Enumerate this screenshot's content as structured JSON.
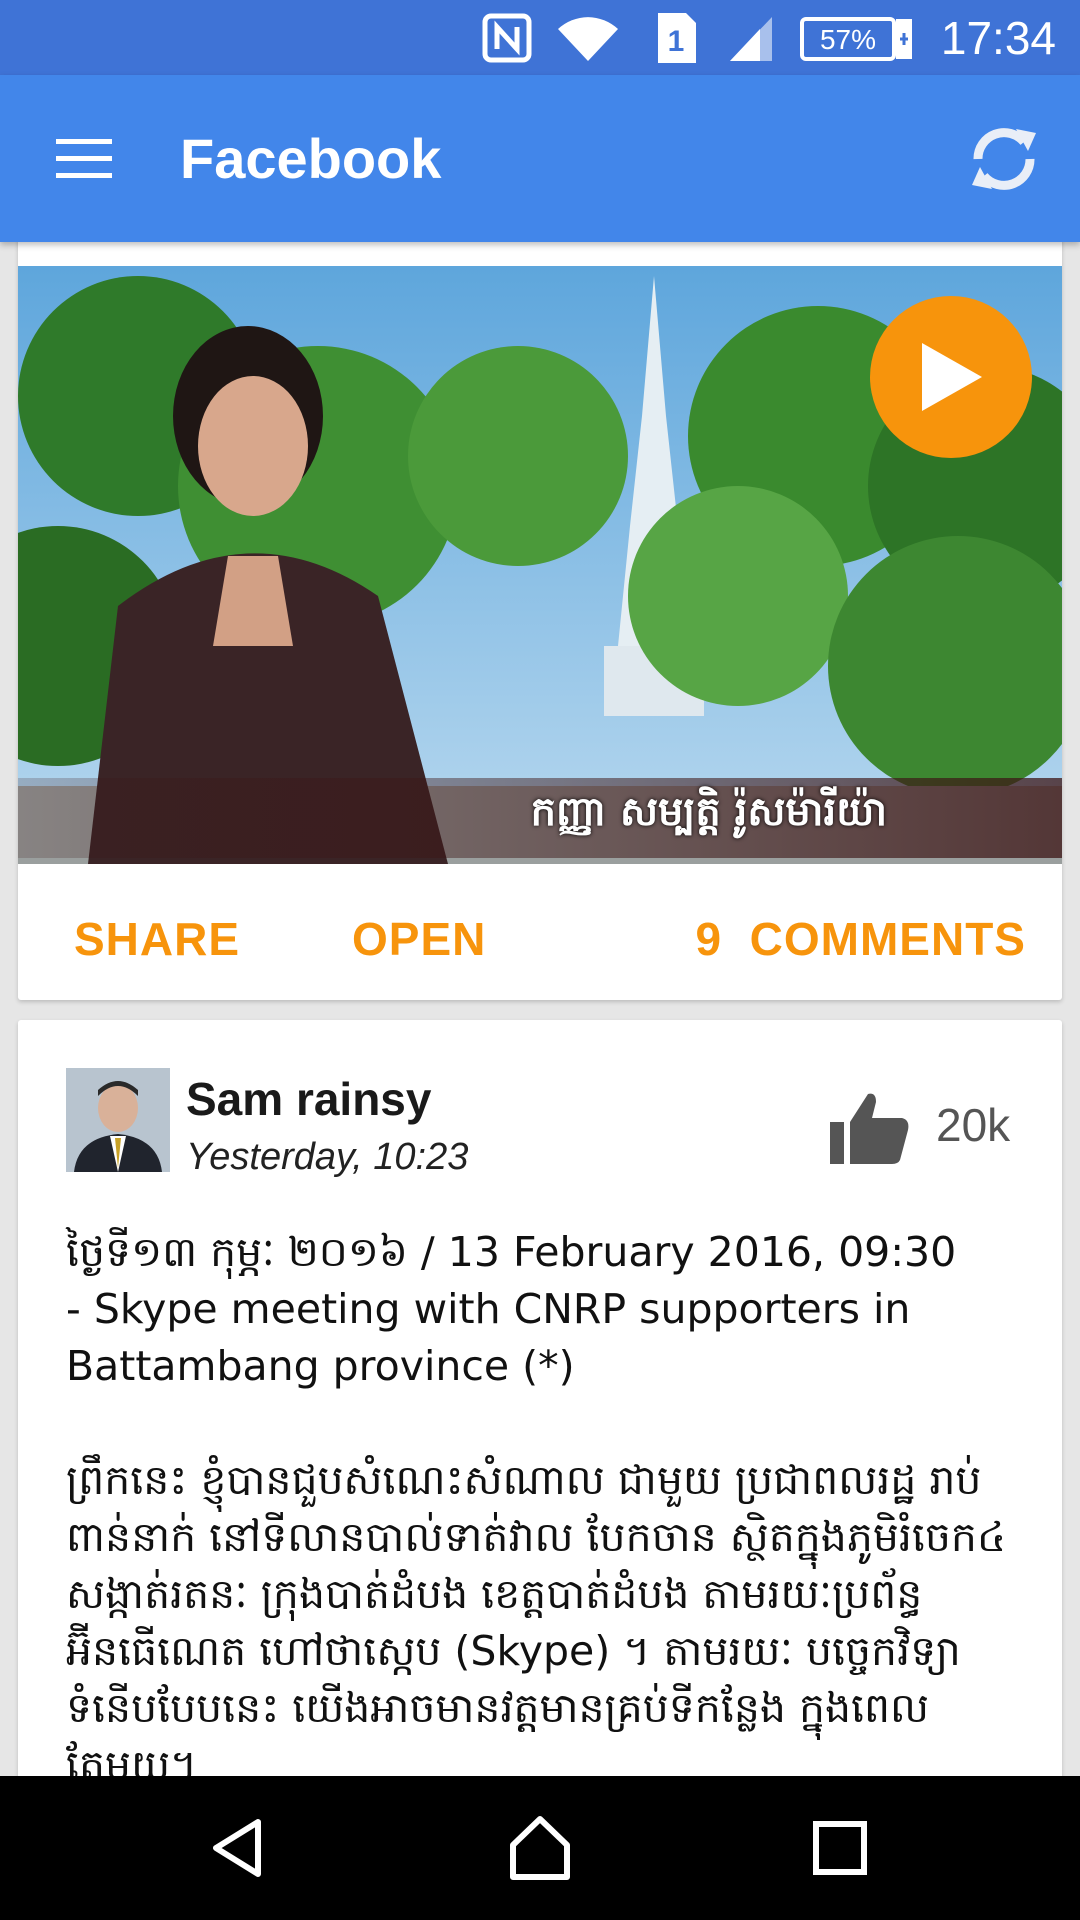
{
  "status_bar": {
    "time": "17:34",
    "battery": "57%",
    "sim_slot": "1",
    "icons": [
      "nfc-icon",
      "wifi-icon",
      "sim-icon",
      "signal-icon",
      "battery-icon"
    ]
  },
  "app_bar": {
    "title": "Facebook",
    "menu_icon": "hamburger-menu-icon",
    "refresh_icon": "refresh-icon"
  },
  "video_card": {
    "caption": "កញ្ញា សម្បត្តិ រ៉ូសម៉ារីយ៉ា",
    "actions": {
      "share": "SHARE",
      "open": "OPEN",
      "comments_count": "9",
      "comments_label": "COMMENTS"
    }
  },
  "post": {
    "author": "Sam rainsy",
    "time": "Yesterday, 10:23",
    "likes": "20k",
    "text": "ថ្ងៃទី១៣ កុម្ភៈ ២០១៦ / 13 February 2016, 09:30\n- Skype meeting with CNRP supporters in Battambang province (*)\n\nព្រឹកនេះ ខ្ញុំបានជួបសំណេះសំណាល ជាមួយ ប្រជាពលរដ្ឋ រាប់ពាន់នាក់ នៅទីលានបាល់ទាត់វាល បែកចាន ស្ថិតក្នុងភូមិរំចេក៤ សង្កាត់រតនៈ ក្រុងបាត់ដំបង ខេត្តបាត់ដំបង តាមរយៈប្រព័ន្ធអ៊ីនធើណេត ហៅថាស្កេប (Skype) ។ តាមរយៈ បច្ចេកវិទ្យាទំនើបបែបនេះ យើងអាចមានវត្តមានគ្រប់ទីកន្លែង ក្នុងពេលតែមួយ។"
  },
  "colors": {
    "status_bar": "#3f73d6",
    "app_bar": "#4286ea",
    "accent": "#f7940c",
    "background": "#e6e6e6"
  }
}
